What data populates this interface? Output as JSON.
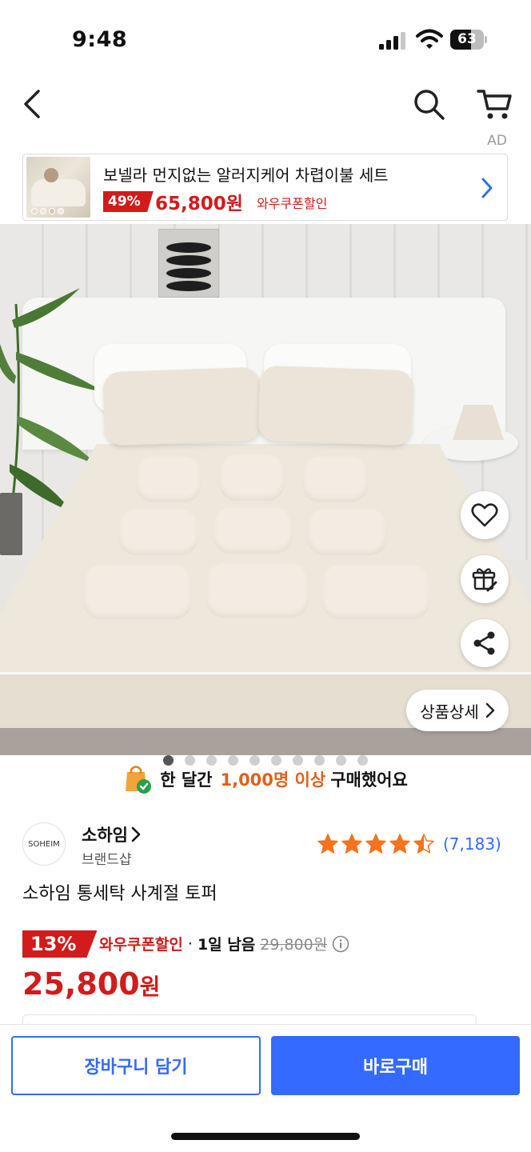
{
  "status": {
    "time": "9:48",
    "battery": "63",
    "battery_level": 0.63
  },
  "icons": {
    "back": "chevron-left-icon",
    "search": "search-icon",
    "cart": "cart-icon",
    "wishlist": "heart-icon",
    "gift": "gift-icon",
    "share": "share-icon",
    "info": "info-icon"
  },
  "ad": {
    "label": "AD",
    "title": "보넬라 먼지없는 알러지케어 차렵이불 세트",
    "discount": "49%",
    "price": "65,800원",
    "coupon": "와우쿠폰할인"
  },
  "gallery": {
    "detail_button": "상품상세",
    "dot_count": 10,
    "active_index": 0
  },
  "social_proof": {
    "prefix": "한 달간",
    "highlight": "1,000명 이상",
    "suffix": "구매했어요"
  },
  "seller": {
    "logo_text": "SOHEIM",
    "name": "소하임",
    "subtitle": "브랜드샵"
  },
  "rating": {
    "stars": 4.5,
    "review_count": "(7,183)"
  },
  "product": {
    "title": "소하임 통세탁 사계절 토퍼"
  },
  "pricing": {
    "discount": "13%",
    "coupon_label": "와우쿠폰할인",
    "separator": "·",
    "time_left": "1일 남음",
    "original_price": "29,800원",
    "final_price": "25,800",
    "currency": "원"
  },
  "actions": {
    "add_to_cart": "장바구니 담기",
    "buy_now": "바로구매"
  },
  "colors": {
    "accent_blue": "#346aff",
    "sale_red": "#d21b1b",
    "highlight_orange": "#e0611b"
  }
}
